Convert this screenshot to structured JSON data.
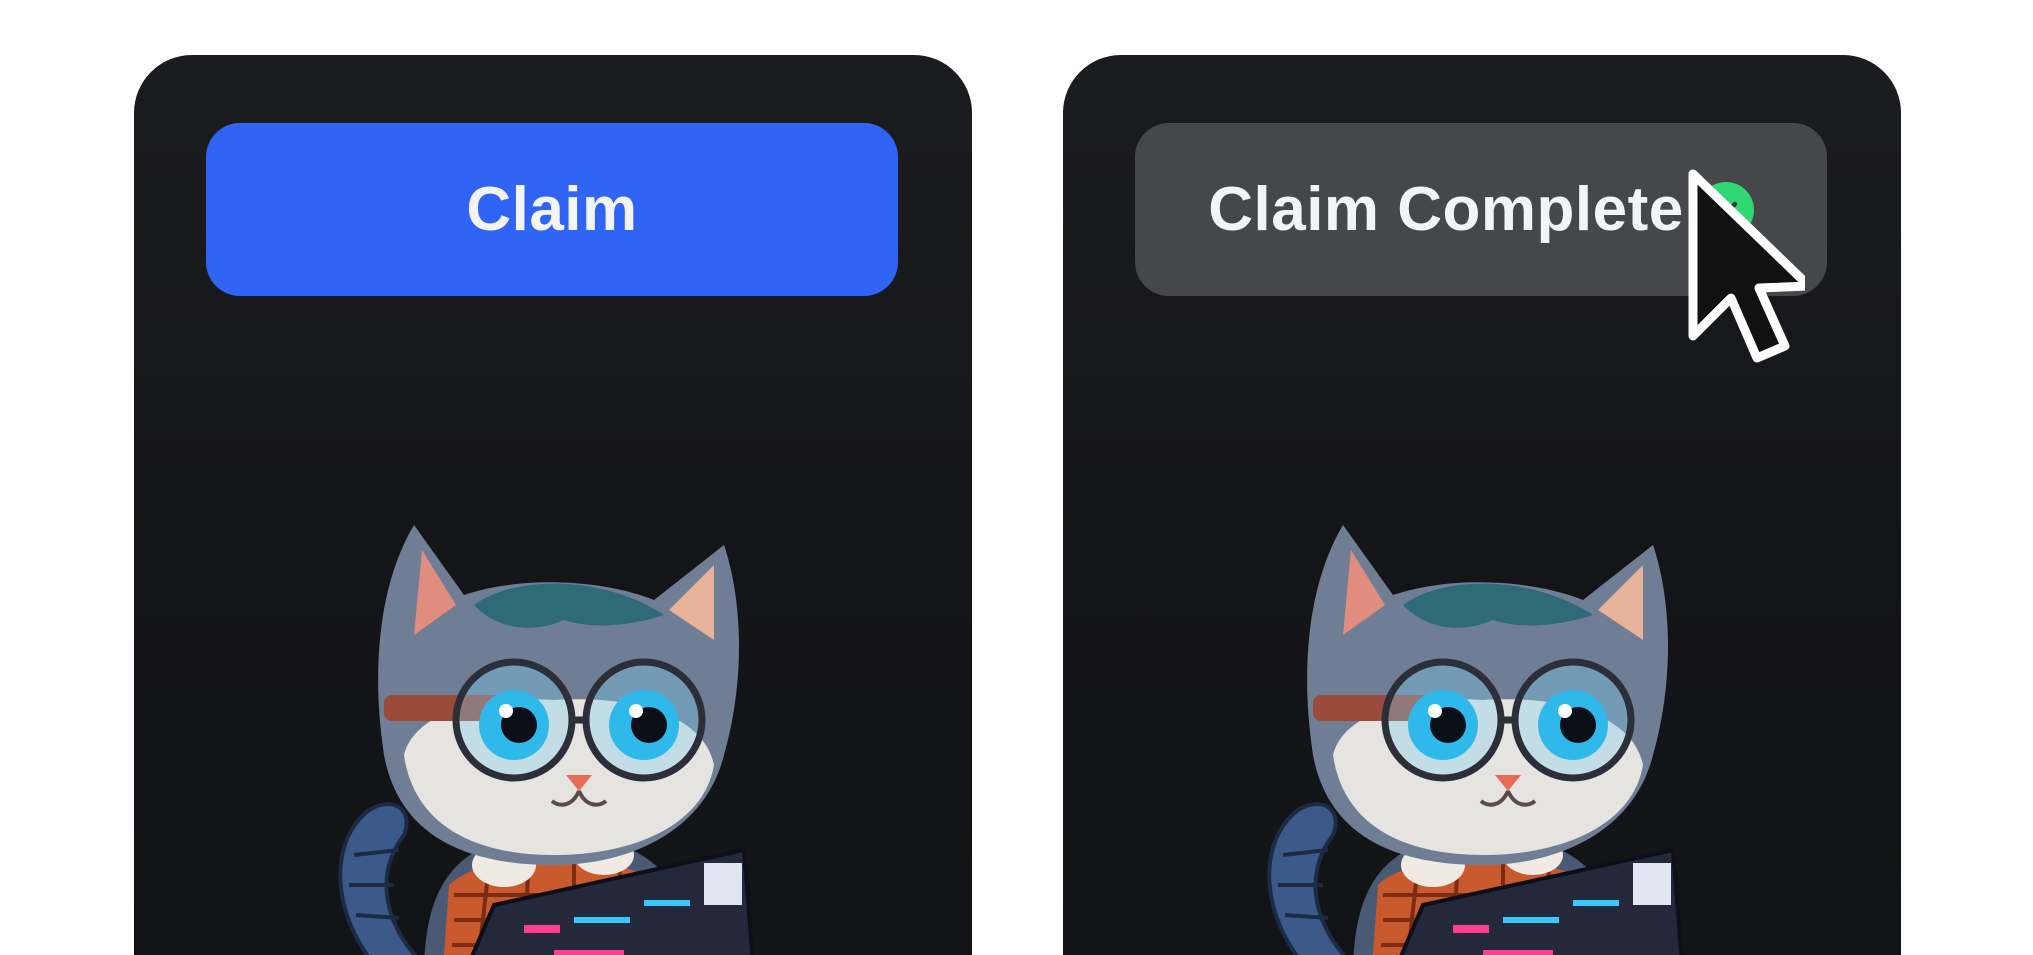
{
  "cards": [
    {
      "state": "unclaimed",
      "button_label": "Claim",
      "button_color": "#2f64f5"
    },
    {
      "state": "claimed",
      "button_label": "Claim Complete",
      "button_color": "#46474b",
      "status_icon": "check-circle-icon",
      "status_color": "#2fd873"
    }
  ],
  "illustration": "cat-with-glasses-and-keyboard",
  "cursor_icon": "pointer-arrow-icon"
}
